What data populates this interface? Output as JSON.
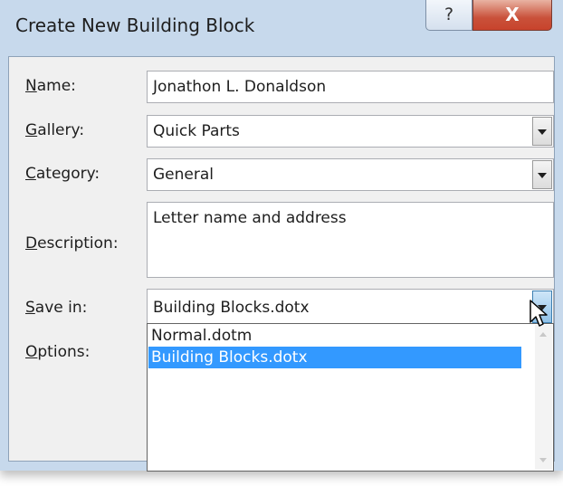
{
  "dialog": {
    "title": "Create New Building Block",
    "help_glyph": "?",
    "close_glyph": "X"
  },
  "form": {
    "name": {
      "label_u": "N",
      "label_rest": "ame:",
      "value": "Jonathon L. Donaldson"
    },
    "gallery": {
      "label_u": "G",
      "label_rest": "allery:",
      "value": "Quick Parts"
    },
    "category": {
      "label_u": "C",
      "label_rest": "ategory:",
      "value": "General"
    },
    "description": {
      "label_u": "D",
      "label_rest": "escription:",
      "value": "Letter name and address"
    },
    "save_in": {
      "label_u": "S",
      "label_rest": "ave in:",
      "value": "Building Blocks.dotx"
    },
    "options": {
      "label_u": "O",
      "label_rest": "ptions:"
    }
  },
  "save_in_dropdown": {
    "options": [
      "Normal.dotm",
      "Building Blocks.dotx"
    ],
    "selected": "Building Blocks.dotx"
  }
}
